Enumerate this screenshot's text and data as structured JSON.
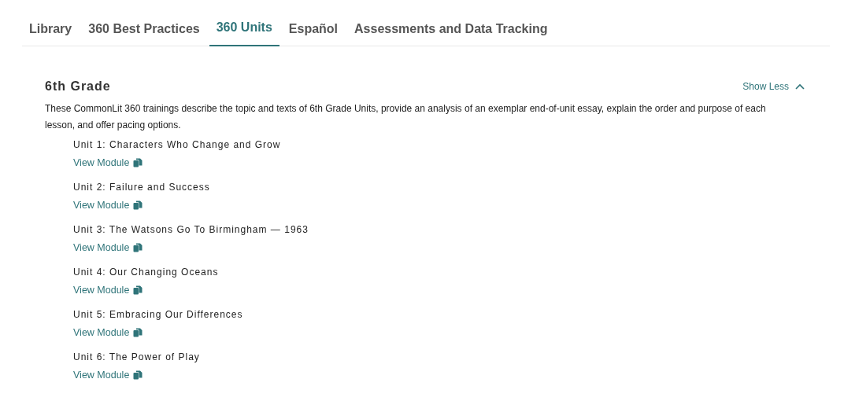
{
  "tabs": [
    {
      "label": "Library",
      "selected": false
    },
    {
      "label": "360 Best Practices",
      "selected": false
    },
    {
      "label": "360 Units",
      "selected": true
    },
    {
      "label": "Español",
      "selected": false
    },
    {
      "label": "Assessments and Data Tracking",
      "selected": false
    }
  ],
  "section": {
    "title": "6th Grade",
    "toggle": "Show Less",
    "expanded": true,
    "description": "These CommonLit 360 trainings describe the topic and texts of 6th Grade Units, provide an analysis of an exemplar end-of-unit essay, explain the order and purpose of each lesson, and offer pacing options.",
    "units": [
      {
        "title": "Unit 1: Characters Who Change and Grow",
        "link": "View Module"
      },
      {
        "title": "Unit 2: Failure and Success",
        "link": "View Module"
      },
      {
        "title": "Unit 3: The Watsons Go To Birmingham — 1963",
        "link": "View Module"
      },
      {
        "title": "Unit 4: Our Changing Oceans",
        "link": "View Module"
      },
      {
        "title": "Unit 5: Embracing Our Differences",
        "link": "View Module"
      },
      {
        "title": "Unit 6: The Power of Play",
        "link": "View Module"
      }
    ]
  }
}
